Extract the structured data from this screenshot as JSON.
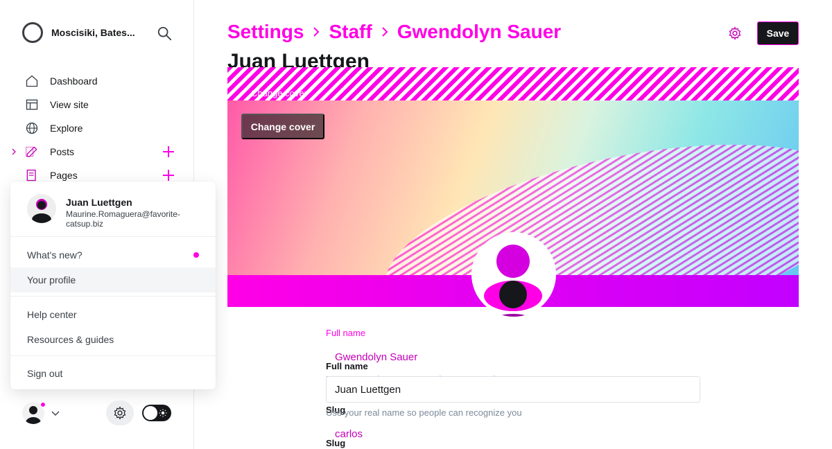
{
  "sidebar": {
    "site_name": "Moscisiki, Bates...",
    "nav": [
      {
        "label": "Dashboard",
        "icon": "home-icon"
      },
      {
        "label": "View site",
        "icon": "browser-icon"
      },
      {
        "label": "Explore",
        "icon": "globe-icon"
      },
      {
        "label": "Posts",
        "icon": "pen-icon"
      },
      {
        "label": "Pages",
        "icon": "page-icon"
      }
    ],
    "user_menu": {
      "name": "Juan Luettgen",
      "email": "Maurine.Romaguera@favorite-catsup.biz",
      "items": [
        {
          "label": "What's new?"
        },
        {
          "label": "Your profile"
        },
        {
          "label": "Help center"
        },
        {
          "label": "Resources & guides"
        },
        {
          "label": "Sign out"
        }
      ]
    }
  },
  "header": {
    "breadcrumb": [
      "Settings",
      "Staff",
      "Gwendolyn Sauer"
    ],
    "title": "Juan Luettgen",
    "save_label": "Save"
  },
  "cover": {
    "change_cover_label": "Change cover"
  },
  "form": {
    "full_name_label": "Full name",
    "full_name_value": "Juan Luettgen",
    "full_name_prev": "Gwendolyn Sauer",
    "full_name_hint": "Use your real name so people can recognize you",
    "slug_label": "Slug",
    "slug_value": "carlos"
  },
  "colors": {
    "accent": "#ff00e6",
    "dark": "#15171a"
  }
}
